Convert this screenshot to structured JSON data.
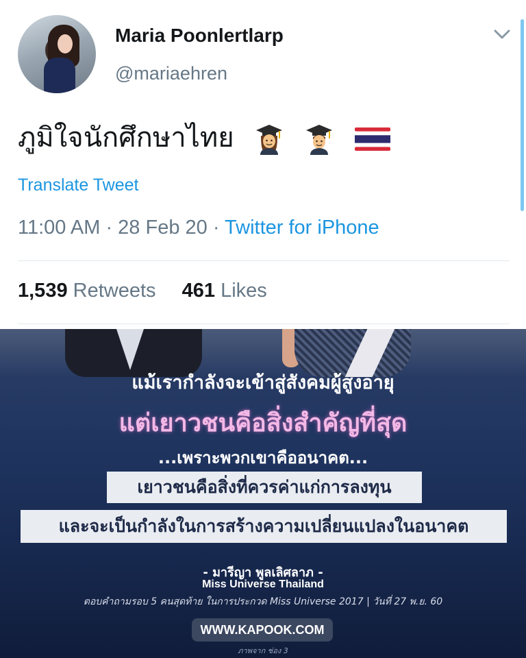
{
  "tweet": {
    "display_name": "Maria Poonlertlarp",
    "handle": "@mariaehren",
    "text": "ภูมิใจนักศึกษาไทย",
    "emojis": [
      "woman-student-icon",
      "man-student-icon",
      "thailand-flag-icon"
    ],
    "translate_label": "Translate Tweet",
    "time": "11:00 AM",
    "date": "28 Feb 20",
    "source": "Twitter for iPhone",
    "separator": " · ",
    "stats": {
      "retweets_count": "1,539",
      "retweets_label": "Retweets",
      "likes_count": "461",
      "likes_label": "Likes"
    }
  },
  "media": {
    "line1": "แม้เรากำลังจะเข้าสู่สังคมผู้สูงอายุ",
    "line2": "แต่เยาวชนคือสิ่งสำคัญที่สุด",
    "line3": "...เพราะพวกเขาคืออนาคต...",
    "box1": "เยาวชนคือสิ่งที่ควรค่าแก่การลงทุน",
    "box2": "และจะเป็นกำลังในการสร้างความเปลี่ยนแปลงในอนาคต",
    "name": "- มารีญา พูลเลิศลาภ -",
    "title": "Miss Universe Thailand",
    "caption": "ตอบคำถามรอบ 5 คนสุดท้าย ในการประกวด Miss Universe 2017 | วันที่ 27 พ.ย. 60",
    "badge": "WWW.KAPOOK.COM",
    "credit": "ภาพจาก ช่อง 3"
  },
  "colors": {
    "link": "#1b95e0",
    "secondary_text": "#657786",
    "primary_text": "#14171a",
    "media_bg": "#17284e",
    "highlight_pink": "#f3b8e6"
  }
}
